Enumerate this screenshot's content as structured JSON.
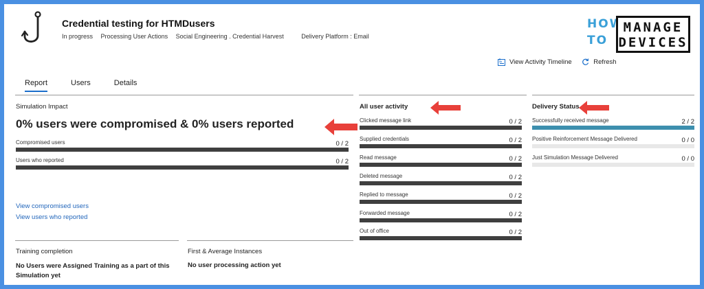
{
  "header": {
    "title": "Credential testing for HTMDusers",
    "status": "In progress",
    "phase": "Processing User Actions",
    "technique": "Social Engineering . Credential Harvest",
    "delivery_platform": "Delivery Platform : Email",
    "icon": "hook-icon"
  },
  "logo": {
    "line1": "HOW",
    "line2": "TO",
    "box1": "MANAGE",
    "box2": "DEVICES"
  },
  "actions": {
    "timeline": "View Activity Timeline",
    "refresh": "Refresh"
  },
  "tabs": [
    {
      "label": "Report",
      "active": true
    },
    {
      "label": "Users",
      "active": false
    },
    {
      "label": "Details",
      "active": false
    }
  ],
  "simulation_impact": {
    "title": "Simulation Impact",
    "headline": "0% users were compromised & 0% users reported",
    "rows": [
      {
        "label": "Compromised users",
        "value": "0 / 2",
        "fill": 1.0
      },
      {
        "label": "Users who reported",
        "value": "0 / 2",
        "fill": 1.0
      }
    ],
    "links": [
      "View compromised users",
      "View users who reported"
    ]
  },
  "user_activity": {
    "title": "All user activity",
    "rows": [
      {
        "label": "Clicked message link",
        "value": "0 / 2",
        "fill": 1.0
      },
      {
        "label": "Supplied credentials",
        "value": "0 / 2",
        "fill": 1.0
      },
      {
        "label": "Read message",
        "value": "0 / 2",
        "fill": 1.0
      },
      {
        "label": "Deleted message",
        "value": "0 / 2",
        "fill": 1.0
      },
      {
        "label": "Replied to message",
        "value": "0 / 2",
        "fill": 1.0
      },
      {
        "label": "Forwarded message",
        "value": "0 / 2",
        "fill": 1.0
      },
      {
        "label": "Out of office",
        "value": "0 / 2",
        "fill": 1.0
      }
    ]
  },
  "delivery_status": {
    "title": "Delivery Status",
    "rows": [
      {
        "label": "Successfully received message",
        "value": "2 / 2",
        "fill": 1.0
      },
      {
        "label": "Positive Reinforcement Message Delivered",
        "value": "0 / 0",
        "fill": 0.0
      },
      {
        "label": "Just Simulation Message Delivered",
        "value": "0 / 0",
        "fill": 0.0
      }
    ]
  },
  "training": {
    "title": "Training completion",
    "text": "No Users were Assigned Training as a part of this Simulation yet"
  },
  "instances": {
    "title": "First & Average Instances",
    "text": "No user processing action yet"
  },
  "colors": {
    "accent": "#1a6ecb",
    "bar_dark": "#3f3f3f",
    "bar_blue": "#3d8fae",
    "arrow": "#e8403a",
    "frame": "#4a90e2"
  }
}
